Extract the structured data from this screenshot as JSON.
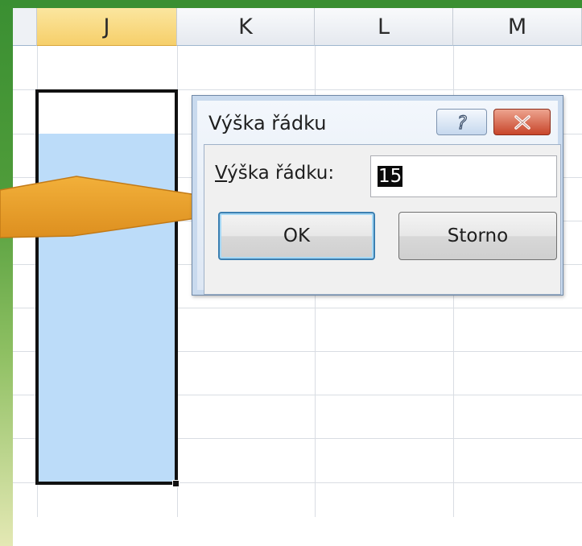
{
  "columns": [
    {
      "name": "",
      "selected": false
    },
    {
      "name": "J",
      "selected": true
    },
    {
      "name": "K",
      "selected": false
    },
    {
      "name": "L",
      "selected": false
    },
    {
      "name": "M",
      "selected": false
    }
  ],
  "dialog": {
    "title": "Výška řádku",
    "help_label": "?",
    "close_label": "x",
    "field_label_accel": "V",
    "field_label_rest": "ýška řádku:",
    "field_value": "15",
    "ok_label": "OK",
    "cancel_label": "Storno"
  },
  "colors": {
    "slide_border": "#3a8f32",
    "selection_fill": "#bcdcf9",
    "selected_header": "#f6cf6a",
    "arrow": "#e8a02a"
  },
  "icons": {
    "help": "question-mark-icon",
    "close": "close-icon",
    "callout": "arrow-callout"
  }
}
